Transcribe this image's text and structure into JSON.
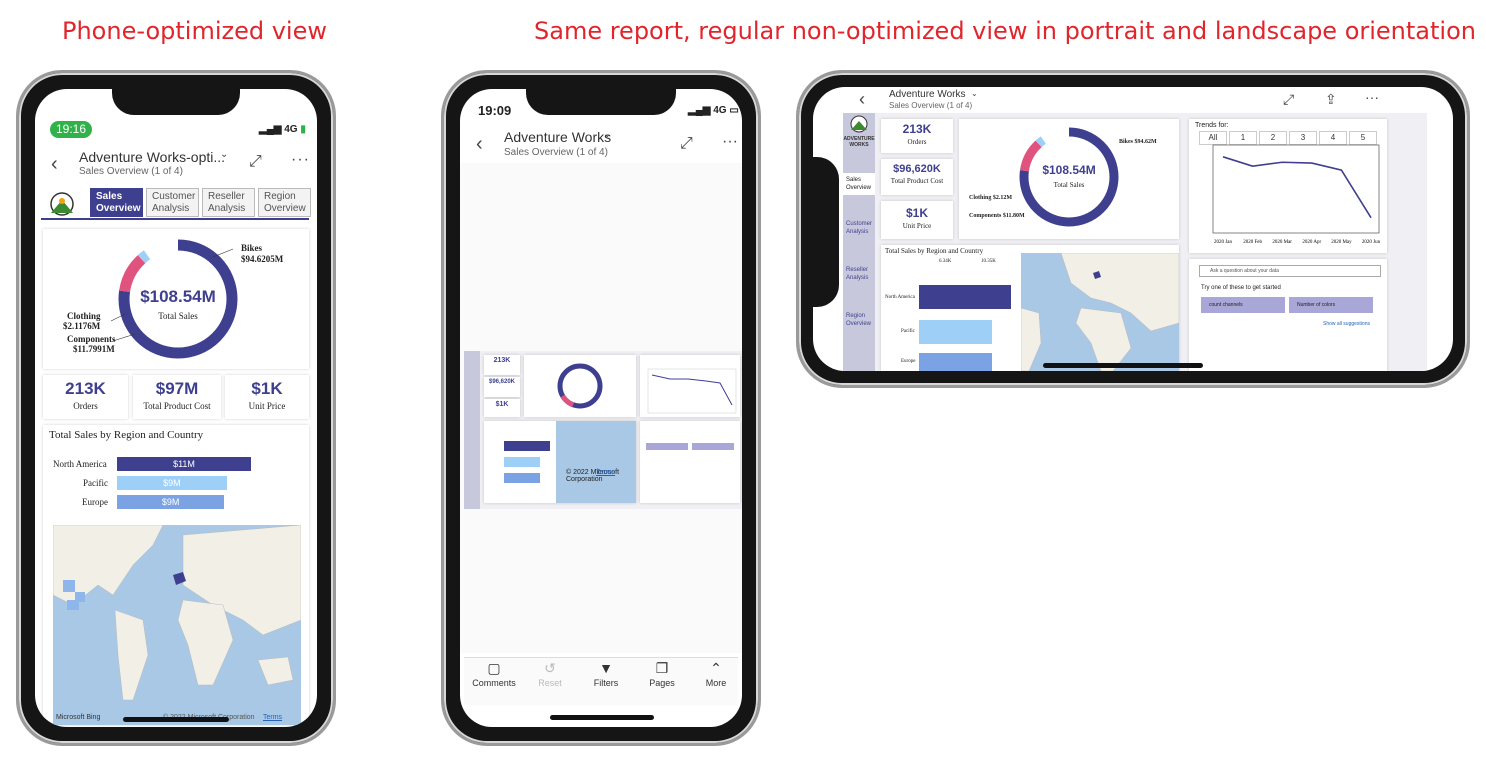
{
  "headings": {
    "left": "Phone-optimized view",
    "right": "Same report, regular non-optimized view in portrait and landscape orientation"
  },
  "colors": {
    "accent": "#3f3f8f",
    "heading": "#e0262c",
    "pink": "#e0537f",
    "light_blue": "#9ecff7",
    "mid_blue": "#7ba3e3",
    "map_water": "#a8c8e6",
    "map_land": "#f2efe6"
  },
  "phone1": {
    "time": "19:16",
    "signal": "4G",
    "title": "Adventure Works-opti...",
    "subtitle": "Sales Overview (1 of 4)",
    "tabs": [
      {
        "label": "Sales Overview"
      },
      {
        "label": "Customer Analysis"
      },
      {
        "label": "Reseller Analysis"
      },
      {
        "label": "Region Overview"
      }
    ],
    "donut": {
      "center_value": "$108.54M",
      "center_label": "Total Sales",
      "bikes": "Bikes",
      "bikes_value": "$94.6205M",
      "clothing": "Clothing",
      "clothing_value": "$2.1176M",
      "components": "Components",
      "components_value": "$11.7991M"
    },
    "kpis": [
      {
        "value": "213K",
        "label": "Orders"
      },
      {
        "value": "$97M",
        "label": "Total Product Cost"
      },
      {
        "value": "$1K",
        "label": "Unit Price"
      }
    ],
    "region_title": "Total Sales by Region and Country",
    "region_bars": [
      {
        "label": "North America",
        "value": "$11M",
        "share": 1.0
      },
      {
        "label": "Pacific",
        "value": "$9M",
        "share": 0.82
      },
      {
        "label": "Europe",
        "value": "$9M",
        "share": 0.8
      }
    ],
    "map_brand": "Microsoft Bing",
    "map_copyright": "© 2022 Microsoft Corporation",
    "map_terms": "Terms"
  },
  "phone2": {
    "time": "19:09",
    "signal": "4G",
    "title": "Adventure Works",
    "subtitle": "Sales Overview (1 of 4)",
    "map_copyright": "© 2022 Microsoft Corporation",
    "map_terms": "Terms",
    "bottom_bar": [
      {
        "icon": "comments-icon",
        "label": "Comments"
      },
      {
        "icon": "reset-icon",
        "label": "Reset"
      },
      {
        "icon": "filter-icon",
        "label": "Filters"
      },
      {
        "icon": "pages-icon",
        "label": "Pages"
      },
      {
        "icon": "chevron-up-icon",
        "label": "More"
      }
    ]
  },
  "phone3": {
    "title": "Adventure Works",
    "subtitle": "Sales Overview (1 of 4)",
    "logo_text": "ADVENTURE WORKS",
    "nav": [
      {
        "label": "Sales Overview"
      },
      {
        "label": "Customer Analysis"
      },
      {
        "label": "Reseller Analysis"
      },
      {
        "label": "Region Overview"
      }
    ],
    "kpis": [
      {
        "value": "213K",
        "label": "Orders"
      },
      {
        "value": "$96,620K",
        "label": "Total Product Cost"
      },
      {
        "value": "$1K",
        "label": "Unit Price"
      }
    ],
    "donut": {
      "center_value": "$108.54M",
      "center_label": "Total Sales",
      "bikes": "Bikes $94.62M",
      "clothing": "Clothing $2.12M",
      "components": "Components $11.80M"
    },
    "trends": {
      "title": "Trends for:",
      "buttons": [
        "All",
        "1",
        "2",
        "3",
        "4",
        "5"
      ]
    },
    "region_title": "Total Sales by Region and Country",
    "region_axis": [
      "6.34K",
      "10.35K"
    ],
    "region_bars": [
      {
        "label": "North America",
        "share": 1.0
      },
      {
        "label": "Pacific",
        "share": 0.79
      },
      {
        "label": "Europe",
        "share": 0.79
      }
    ],
    "qa": {
      "placeholder": "Ask a question about your data",
      "try": "Try one of these to get started",
      "suggestions": [
        "count channels",
        "Number of colors"
      ],
      "show_all": "Show all suggestions"
    }
  },
  "chart_data": [
    {
      "type": "pie",
      "title": "",
      "categories": [
        "Bikes",
        "Clothing",
        "Components"
      ],
      "values": [
        94.6205,
        2.1176,
        11.7991
      ],
      "center_value": "$108.54M",
      "center_label": "Total Sales"
    },
    {
      "type": "bar",
      "title": "Total Sales by Region and Country",
      "categories": [
        "North America",
        "Pacific",
        "Europe"
      ],
      "values": [
        11,
        9,
        9
      ],
      "ylabel": "$M"
    },
    {
      "type": "line",
      "title": "Trends for:",
      "x": [
        "2020 Jan",
        "2020 Feb",
        "2020 Mar",
        "2020 Apr",
        "2020 May",
        "2020 Jun"
      ],
      "values": [
        0.9,
        0.78,
        0.83,
        0.82,
        0.73,
        0.12
      ]
    }
  ]
}
